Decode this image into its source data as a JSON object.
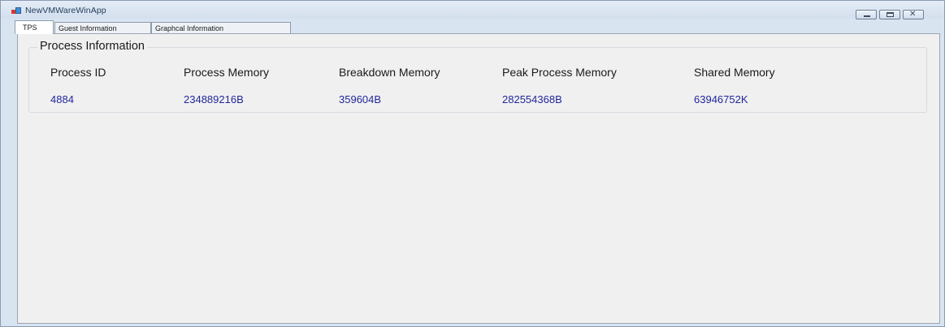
{
  "window": {
    "title": "NewVMWareWinApp",
    "controls": {
      "minimize": "minimize-icon",
      "maximize": "maximize-icon",
      "close": "✕"
    }
  },
  "tabs": [
    {
      "label": "TPS",
      "selected": true
    },
    {
      "label": "Guest Information",
      "selected": false
    },
    {
      "label": "Graphcal Information",
      "selected": false
    }
  ],
  "process_group": {
    "title": "Process Information",
    "columns": [
      {
        "label": "Process ID",
        "value": "4884"
      },
      {
        "label": "Process Memory",
        "value": "234889216B"
      },
      {
        "label": "Breakdown Memory",
        "value": "359604B"
      },
      {
        "label": "Peak Process Memory",
        "value": "282554368B"
      },
      {
        "label": "Shared Memory",
        "value": "63946752K"
      }
    ]
  },
  "colors": {
    "value_text": "#22279a",
    "window_frame": "#d9e4f1",
    "panel_background": "#f0f0f0"
  }
}
